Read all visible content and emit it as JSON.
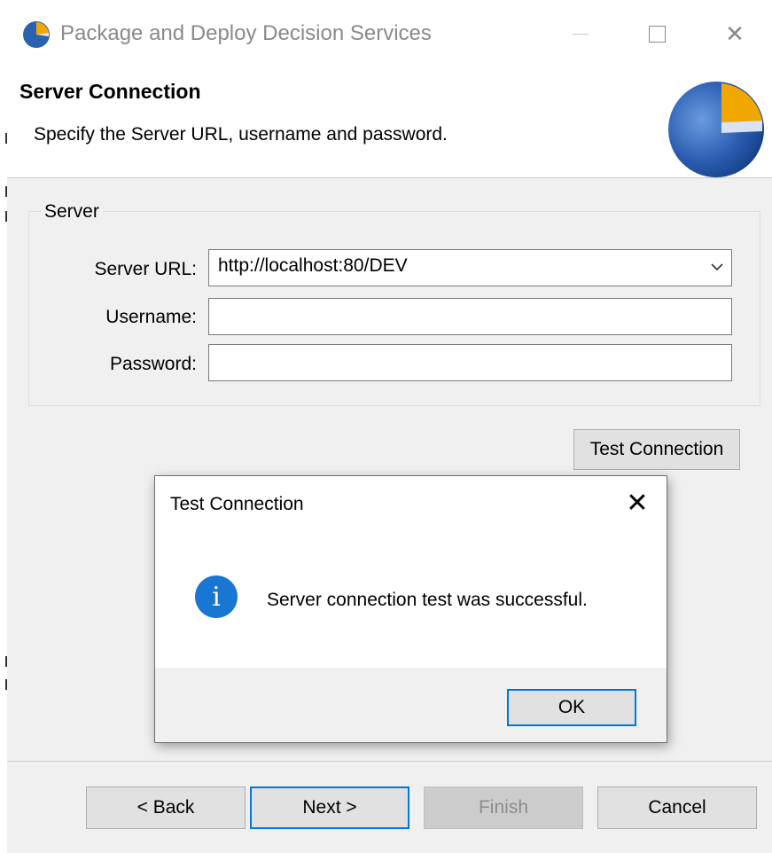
{
  "window": {
    "title": "Package and Deploy Decision Services",
    "icon": "app-logo-icon"
  },
  "header": {
    "title": "Server Connection",
    "description": "Specify the Server URL, username and password."
  },
  "server_group": {
    "legend": "Server",
    "server_url_label": "Server URL:",
    "server_url_value": "http://localhost:80/DEV",
    "username_label": "Username:",
    "username_value": "",
    "password_label": "Password:",
    "password_value": ""
  },
  "test_connection_label": "Test Connection",
  "dialog": {
    "title": "Test Connection",
    "message": "Server connection test was successful.",
    "ok_label": "OK",
    "info_glyph": "i"
  },
  "footer": {
    "back_label": "< Back",
    "next_label": "Next >",
    "finish_label": "Finish",
    "cancel_label": "Cancel"
  },
  "colors": {
    "accent_blue": "#0078d7",
    "info_blue": "#1976d2",
    "logo_orange": "#f0a800"
  }
}
